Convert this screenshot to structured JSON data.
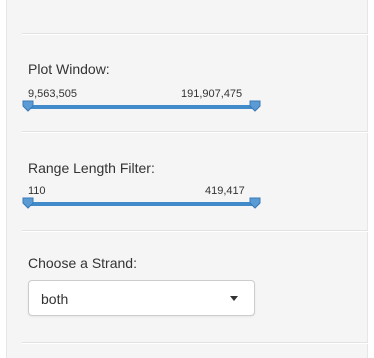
{
  "plot_window": {
    "label": "Plot Window:",
    "min_text": "9,563,505",
    "max_text": "191,907,475",
    "range_fraction": [
      0.0,
      1.0
    ]
  },
  "range_length_filter": {
    "label": "Range Length Filter:",
    "min_text": "110",
    "max_text": "419,417",
    "range_fraction": [
      0.0,
      1.0
    ]
  },
  "strand": {
    "label": "Choose a Strand:",
    "selected": "both"
  },
  "colors": {
    "slider_fill": "#428bca",
    "panel_bg": "#f5f5f5"
  }
}
